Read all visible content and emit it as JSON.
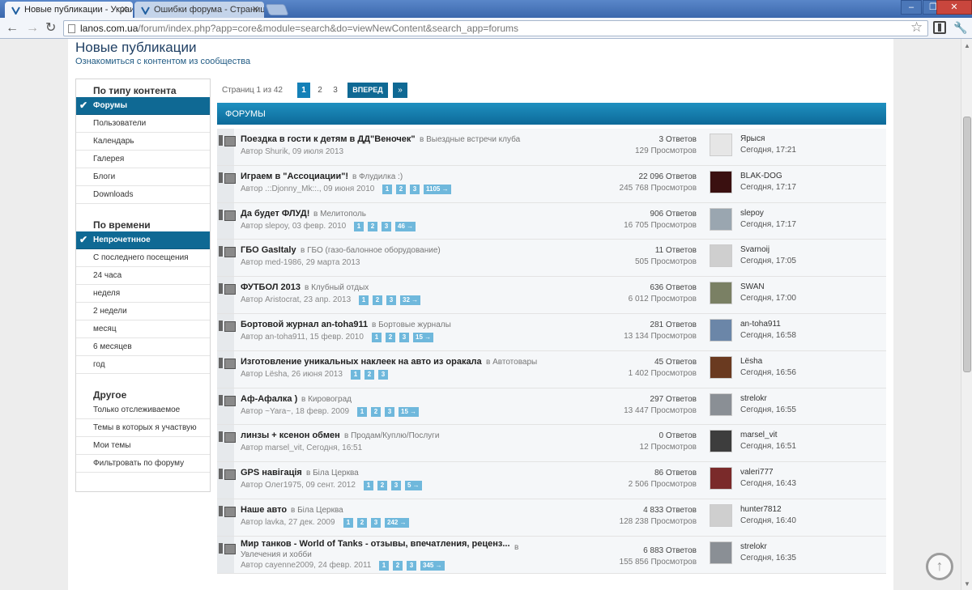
{
  "browser": {
    "tabs": [
      {
        "title": "Новые публикации - Украи",
        "active": true
      },
      {
        "title": "Ошибки форума - Страниц",
        "active": false
      }
    ],
    "url_host": "lanos.com.ua",
    "url_path": "/forum/index.php?app=core&module=search&do=viewNewContent&search_app=forums"
  },
  "page": {
    "title": "Новые публикации",
    "subtitle": "Ознакомиться с контентом из сообщества"
  },
  "sidebar": {
    "content_type": {
      "heading": "По типу контента",
      "items": [
        "Форумы",
        "Пользователи",
        "Календарь",
        "Галерея",
        "Блоги",
        "Downloads"
      ]
    },
    "time": {
      "heading": "По времени",
      "items": [
        "Непрочетнное",
        "С последнего посещения",
        "24 часа",
        "неделя",
        "2 недели",
        "месяц",
        "6 месяцев",
        "год"
      ]
    },
    "other": {
      "heading": "Другое",
      "items": [
        "Только отслеживаемое",
        "Темы в которых я участвую",
        "Мои темы",
        "Фильтровать по форуму"
      ]
    }
  },
  "pagination": {
    "label": "Страниц 1 из 42",
    "pages": [
      "1",
      "2",
      "3"
    ],
    "next": "ВПЕРЕД",
    "last": "»"
  },
  "section_header": "ФОРУМЫ",
  "topics": [
    {
      "title": "Поездка в гости к детям в ДД\"Веночек\"",
      "forum": "в Выездные встречи клуба",
      "author": "Автор Shurik, 09 июля 2013",
      "pages": [],
      "replies": "3 Ответов",
      "views": "129 Просмотров",
      "last_user": "Ярыся",
      "last_time": "Сегодня, 17:21",
      "avatar_color": "#e6e6e6"
    },
    {
      "title": "Играем в \"Ассоциации\"!",
      "forum": "в Флудилка :)",
      "author": "Автор .::Djonny_Mk::., 09 июня 2010",
      "pages": [
        "1",
        "2",
        "3",
        "1105 →"
      ],
      "replies": "22 096 Ответов",
      "views": "245 768 Просмотров",
      "last_user": "BLAK-DOG",
      "last_time": "Сегодня, 17:17",
      "avatar_color": "#3a1010"
    },
    {
      "title": "Да будет ФЛУД!",
      "forum": "в Мелитополь",
      "author": "Автор slepoy, 03 февр. 2010",
      "pages": [
        "1",
        "2",
        "3",
        "46 →"
      ],
      "replies": "906 Ответов",
      "views": "16 705 Просмотров",
      "last_user": "slepoy",
      "last_time": "Сегодня, 17:17",
      "avatar_color": "#9aa6b0"
    },
    {
      "title": "ГБО GasItaly",
      "forum": "в ГБО (газо-балонное оборудование)",
      "author": "Автор med-1986, 29 марта 2013",
      "pages": [],
      "replies": "11 Ответов",
      "views": "505 Просмотров",
      "last_user": "Svarnoij",
      "last_time": "Сегодня, 17:05",
      "avatar_color": "#cfcfcf"
    },
    {
      "title": "ФУТБОЛ 2013",
      "forum": "в Клубный отдых",
      "author": "Автор Aristocrat, 23 апр. 2013",
      "pages": [
        "1",
        "2",
        "3",
        "32 →"
      ],
      "replies": "636 Ответов",
      "views": "6 012 Просмотров",
      "last_user": "SWAN",
      "last_time": "Сегодня, 17:00",
      "avatar_color": "#7a8064"
    },
    {
      "title": "Бортовой журнал an-toha911",
      "forum": "в Бортовые журналы",
      "author": "Автор an-toha911, 15 февр. 2010",
      "pages": [
        "1",
        "2",
        "3",
        "15 →"
      ],
      "replies": "281 Ответов",
      "views": "13 134 Просмотров",
      "last_user": "an-toha911",
      "last_time": "Сегодня, 16:58",
      "avatar_color": "#6b86a8"
    },
    {
      "title": "Изготовление уникальных наклеек на авто из оракала",
      "forum": "в Автотовары",
      "author": "Автор Lësha, 26 июня 2013",
      "pages": [
        "1",
        "2",
        "3"
      ],
      "replies": "45 Ответов",
      "views": "1 402 Просмотров",
      "last_user": "Lësha",
      "last_time": "Сегодня, 16:56",
      "avatar_color": "#6a3a20"
    },
    {
      "title": "Аф-Афалка )",
      "forum": "в Кировоград",
      "author": "Автор ~Yara~, 18 февр. 2009",
      "pages": [
        "1",
        "2",
        "3",
        "15 →"
      ],
      "replies": "297 Ответов",
      "views": "13 447 Просмотров",
      "last_user": "strelokr",
      "last_time": "Сегодня, 16:55",
      "avatar_color": "#8a8f95"
    },
    {
      "title": "линзы + ксенон обмен",
      "forum": "в Продам/Куплю/Послуги",
      "author": "Автор marsel_vit, Сегодня, 16:51",
      "pages": [],
      "replies": "0 Ответов",
      "views": "12 Просмотров",
      "last_user": "marsel_vit",
      "last_time": "Сегодня, 16:51",
      "avatar_color": "#3d3d3d"
    },
    {
      "title": "GPS навігація",
      "forum": "в Біла Церква",
      "author": "Автор Олег1975, 09 сент. 2012",
      "pages": [
        "1",
        "2",
        "3",
        "5 →"
      ],
      "replies": "86 Ответов",
      "views": "2 506 Просмотров",
      "last_user": "valeri777",
      "last_time": "Сегодня, 16:43",
      "avatar_color": "#7a2a2a"
    },
    {
      "title": "Наше авто",
      "forum": "в Біла Церква",
      "author": "Автор lavka, 27 дек. 2009",
      "pages": [
        "1",
        "2",
        "3",
        "242 →"
      ],
      "replies": "4 833 Ответов",
      "views": "128 238 Просмотров",
      "last_user": "hunter7812",
      "last_time": "Сегодня, 16:40",
      "avatar_color": "#cfcfcf"
    },
    {
      "title": "Мир танков - World of Tanks - отзывы, впечатления, реценз...",
      "forum": "в",
      "forum2": "Увлечения и хобби",
      "author": "Автор cayenne2009, 24 февр. 2011",
      "pages": [
        "1",
        "2",
        "3",
        "345 →"
      ],
      "replies": "6 883 Ответов",
      "views": "155 856 Просмотров",
      "last_user": "strelokr",
      "last_time": "Сегодня, 16:35",
      "avatar_color": "#8a8f95"
    }
  ],
  "colors": {
    "accent": "#0f6994",
    "header_gradient": "#1f90c0",
    "page_badge": "#6fb8dc"
  }
}
